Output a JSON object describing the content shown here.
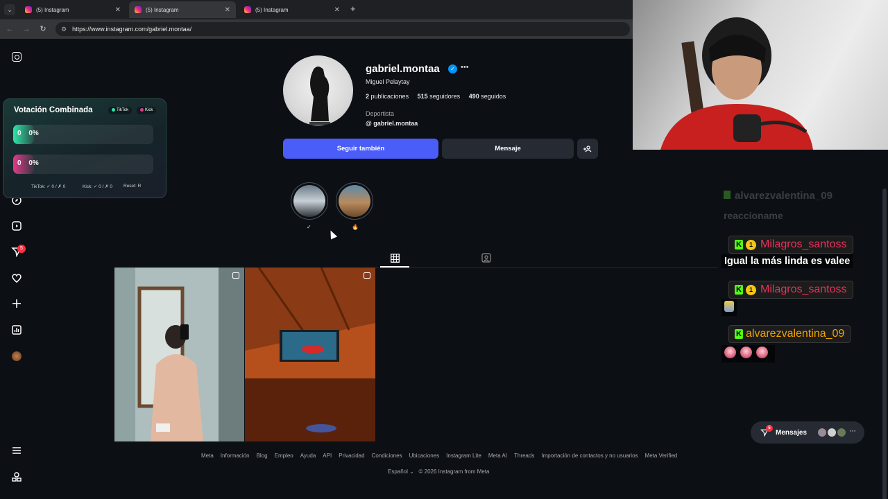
{
  "browser": {
    "tabs": [
      {
        "title": "(5) Instagram"
      },
      {
        "title": "(5) Instagram"
      },
      {
        "title": "(5) Instagram"
      }
    ],
    "url": "https://www.instagram.com/gabriel.montaa/"
  },
  "sidebar": {
    "icons": [
      "instagram-logo-icon",
      "home-icon",
      "search-icon",
      "explore-icon",
      "reels-icon",
      "direct-icon",
      "heart-icon",
      "create-icon",
      "dashboard-icon",
      "profile-avatar",
      "menu-icon",
      "threads-icon"
    ],
    "notification_count": "5"
  },
  "vote_widget": {
    "title": "Votación Combinada",
    "tag_tiktok": "TikTok",
    "tag_kick": "Kick",
    "bar1": {
      "count": "0",
      "percent": "0%",
      "color": "#2ee6a8"
    },
    "bar2": {
      "count": "0",
      "percent": "0%",
      "color": "#e03a8a"
    },
    "footer_tiktok": "TikTok: ✓ 0 / ✗ 0",
    "footer_kick": "Kick: ✓ 0 / ✗ 0",
    "footer_reset": "Reset: R"
  },
  "profile": {
    "username": "gabriel.montaa",
    "fullname": "Miguel Pelaytay",
    "posts_count": "2",
    "posts_label": "publicaciones",
    "followers_count": "515",
    "followers_label": "seguidores",
    "following_count": "490",
    "following_label": "seguidos",
    "category": "Deportista",
    "threads_handle": "gabriel.montaa",
    "follow_button": "Seguir también",
    "message_button": "Mensaje",
    "highlights": [
      {
        "label": "✓"
      },
      {
        "label": "🔥"
      }
    ]
  },
  "footer": {
    "links": [
      "Meta",
      "Información",
      "Blog",
      "Empleo",
      "Ayuda",
      "API",
      "Privacidad",
      "Condiciones",
      "Ubicaciones",
      "Instagram Lite",
      "Meta AI",
      "Threads",
      "Importación de contactos y no usuarios",
      "Meta Verified"
    ],
    "language": "Español",
    "copyright": "© 2026 Instagram from Meta"
  },
  "chat": {
    "faded_user": "alvarezvalentina_09",
    "faded_message": "reaccioname",
    "messages": [
      {
        "user": "Milagros_santoss",
        "text": "Igual la más linda es valee",
        "color": "#e8305a"
      },
      {
        "user": "Milagros_santoss",
        "text": "",
        "color": "#e8305a"
      },
      {
        "user": "alvarezvalentina_09",
        "text": "",
        "color": "#f0a500"
      }
    ]
  },
  "messages_pill": {
    "label": "Mensajes",
    "badge": "5"
  }
}
